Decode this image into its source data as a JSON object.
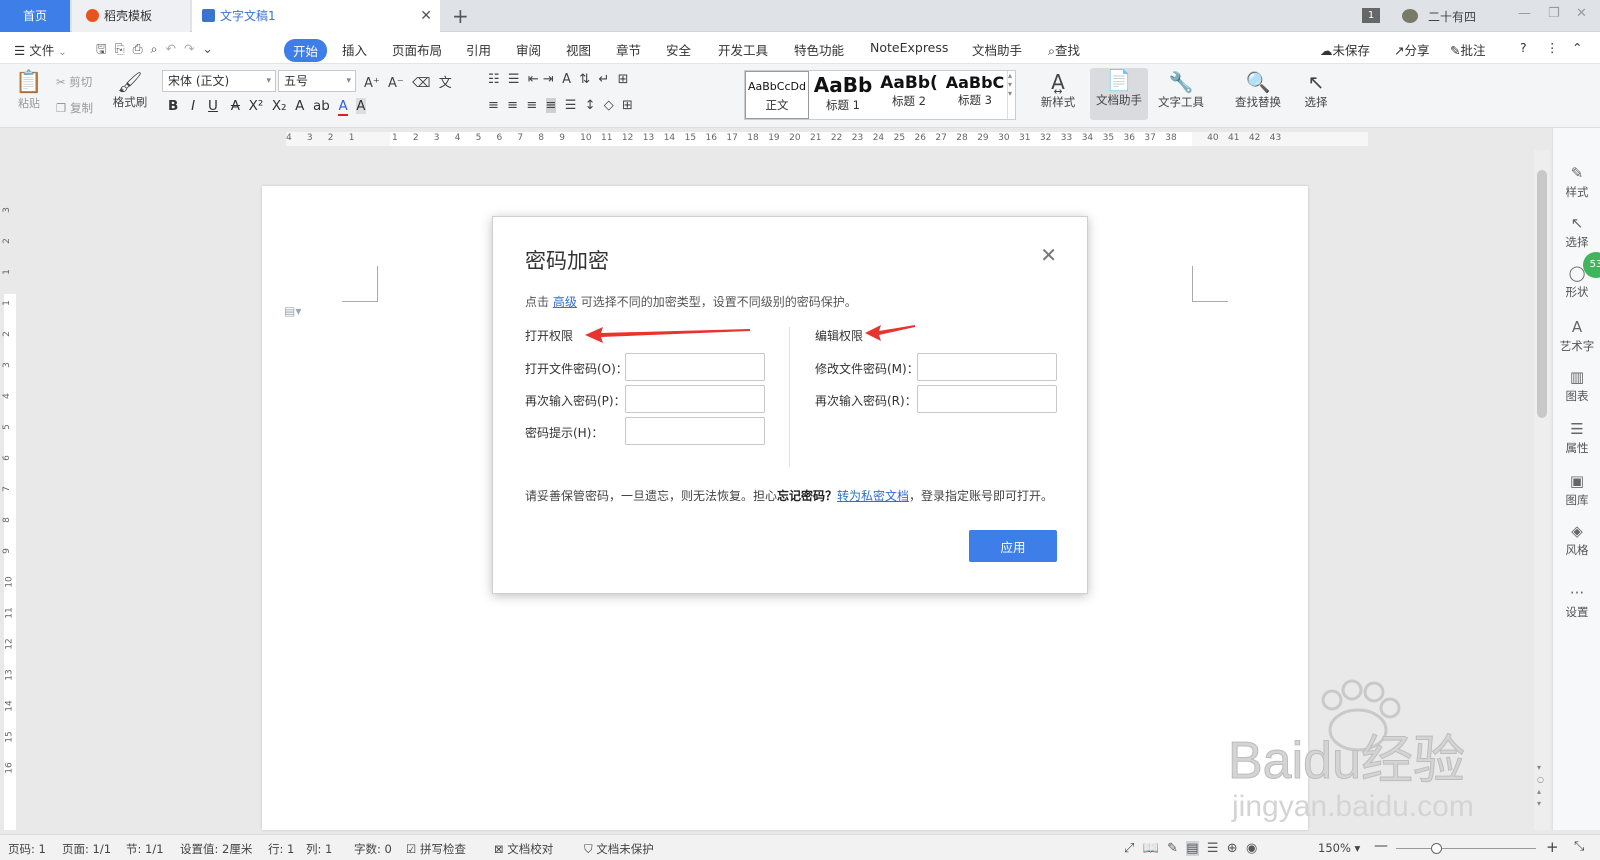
{
  "tabs": {
    "home": "首页",
    "daoke": "稻壳模板",
    "doc": "文字文稿1",
    "close": "✕",
    "add": "+"
  },
  "titlebar_right": {
    "badge": "1",
    "user": "二十有四",
    "minimize": "—",
    "restore": "❐",
    "close": "✕"
  },
  "menu": {
    "file": "文件",
    "start": "开始",
    "items": [
      "插入",
      "页面布局",
      "引用",
      "审阅",
      "视图",
      "章节",
      "安全",
      "开发工具",
      "特色功能",
      "NoteExpress",
      "文档助手"
    ],
    "search": "查找",
    "unsaved": "未保存",
    "share": "分享",
    "comment": "批注"
  },
  "ribbon": {
    "paste": "粘贴",
    "cut": "剪切",
    "copy": "复制",
    "format_painter": "格式刷",
    "font_name": "宋体 (正文)",
    "font_size": "五号",
    "styles": [
      {
        "preview": "AaBbCcDd",
        "label": "正文"
      },
      {
        "preview": "AaBb",
        "label": "标题 1"
      },
      {
        "preview": "AaBb(",
        "label": "标题 2"
      },
      {
        "preview": "AaBbC",
        "label": "标题 3"
      }
    ],
    "new_style": "新样式",
    "doc_helper": "文档助手",
    "text_tool": "文字工具",
    "find_replace": "查找替换",
    "select": "选择"
  },
  "ruler": {
    "left": [
      "4",
      "3",
      "2",
      "1"
    ],
    "right": [
      "1",
      "2",
      "3",
      "4",
      "5",
      "6",
      "7",
      "8",
      "9",
      "10",
      "11",
      "12",
      "13",
      "14",
      "15",
      "16",
      "17",
      "18",
      "19",
      "20",
      "21",
      "22",
      "23",
      "24",
      "25",
      "26",
      "27",
      "28",
      "29",
      "30",
      "31",
      "32",
      "33",
      "34",
      "35",
      "36",
      "37",
      "38",
      "40",
      "41",
      "42",
      "43"
    ]
  },
  "vruler_nums": [
    "3",
    "2",
    "1",
    "1",
    "2",
    "3",
    "4",
    "5",
    "6",
    "7",
    "8",
    "9",
    "10",
    "11",
    "12",
    "13",
    "14",
    "15",
    "16"
  ],
  "sidebar": {
    "items": [
      "样式",
      "选择",
      "形状",
      "艺术字",
      "图表",
      "属性",
      "图库",
      "风格",
      "设置"
    ],
    "badge": "53"
  },
  "dialog": {
    "title": "密码加密",
    "tip_prefix": "点击",
    "tip_link": "高级",
    "tip_suffix": "可选择不同的加密类型，设置不同级别的密码保护。",
    "open_section": "打开权限",
    "edit_section": "编辑权限",
    "open_pwd_label": "打开文件密码(O)：",
    "open_pwd_confirm_label": "再次输入密码(P)：",
    "hint_label": "密码提示(H)：",
    "edit_pwd_label": "修改文件密码(M)：",
    "edit_pwd_confirm_label": "再次输入密码(R)：",
    "warn_prefix": "请妥善保管密码，一旦遗忘，则无法恢复。担心",
    "warn_bold": "忘记密码？",
    "warn_link": "转为私密文档",
    "warn_suffix": "，登录指定账号即可打开。",
    "apply": "应用",
    "close": "✕"
  },
  "status": {
    "page_code": "页码: 1",
    "page": "页面: 1/1",
    "section": "节: 1/1",
    "setting": "设置值: 2厘米",
    "row": "行: 1",
    "col": "列: 1",
    "words": "字数: 0",
    "spell": "拼写检查",
    "proof": "文档校对",
    "protect": "文档未保护",
    "zoom": "150%"
  },
  "watermark": {
    "brand": "Baidu经验",
    "url": "jingyan.baidu.com"
  },
  "colors": {
    "accent": "#3d7ee8",
    "arrow": "#e8332f"
  }
}
